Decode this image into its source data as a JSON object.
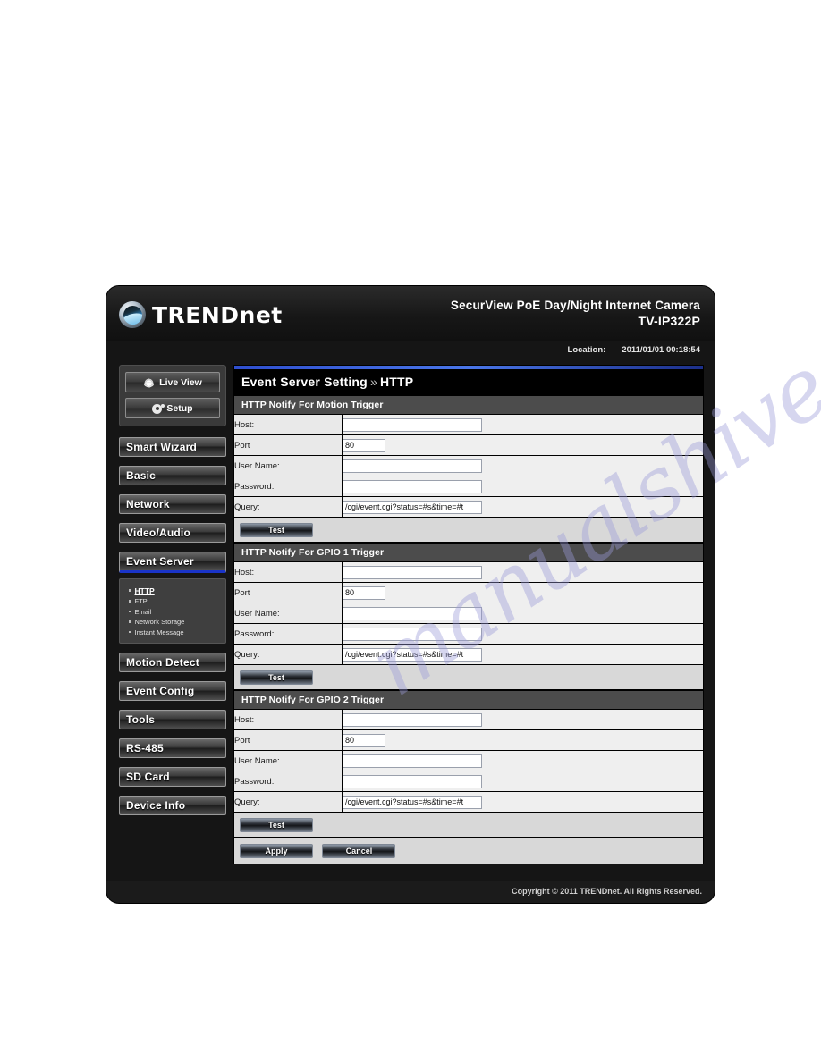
{
  "header": {
    "brand": "TRENDnet",
    "product_line": "SecurView PoE Day/Night Internet Camera",
    "model": "TV-IP322P",
    "location_label": "Location:",
    "location_value": "2011/01/01 00:18:54"
  },
  "nav": {
    "top_buttons": [
      {
        "label": "Live View",
        "icon": "eye-icon"
      },
      {
        "label": "Setup",
        "icon": "gear-icon"
      }
    ],
    "sections": [
      {
        "label": "Smart Wizard",
        "active": false
      },
      {
        "label": "Basic",
        "active": false
      },
      {
        "label": "Network",
        "active": false
      },
      {
        "label": "Video/Audio",
        "active": false
      },
      {
        "label": "Event Server",
        "active": true
      },
      {
        "label": "Motion Detect",
        "active": false
      },
      {
        "label": "Event Config",
        "active": false
      },
      {
        "label": "Tools",
        "active": false
      },
      {
        "label": "RS-485",
        "active": false
      },
      {
        "label": "SD Card",
        "active": false
      },
      {
        "label": "Device Info",
        "active": false
      }
    ],
    "submenu": [
      {
        "label": "HTTP",
        "active": true
      },
      {
        "label": "FTP",
        "active": false
      },
      {
        "label": "Email",
        "active": false
      },
      {
        "label": "Network Storage",
        "active": false
      },
      {
        "label": "Instant Message",
        "active": false
      }
    ]
  },
  "page": {
    "title_main": "Event Server Setting",
    "title_sep": "»",
    "title_sub": "HTTP"
  },
  "labels": {
    "host": "Host:",
    "port": "Port",
    "username": "User Name:",
    "password": "Password:",
    "query": "Query:"
  },
  "groups": [
    {
      "title": "HTTP Notify For Motion Trigger",
      "host": "",
      "port": "80",
      "username": "",
      "password": "",
      "query": "/cgi/event.cgi?status=#s&time=#t",
      "test_label": "Test"
    },
    {
      "title": "HTTP Notify For GPIO 1 Trigger",
      "host": "",
      "port": "80",
      "username": "",
      "password": "",
      "query": "/cgi/event.cgi?status=#s&time=#t",
      "test_label": "Test"
    },
    {
      "title": "HTTP Notify For GPIO 2 Trigger",
      "host": "",
      "port": "80",
      "username": "",
      "password": "",
      "query": "/cgi/event.cgi?status=#s&time=#t",
      "test_label": "Test"
    }
  ],
  "actions": {
    "apply_label": "Apply",
    "cancel_label": "Cancel"
  },
  "footer": {
    "copyright": "Copyright © 2011 TRENDnet. All Rights Reserved."
  },
  "watermark": {
    "text": "manualshive.com"
  },
  "colors": {
    "accent_blue": "#1a34c8",
    "panel_bg": "#efefef",
    "group_header": "#4c4c4c",
    "device_bg": "#151515"
  }
}
